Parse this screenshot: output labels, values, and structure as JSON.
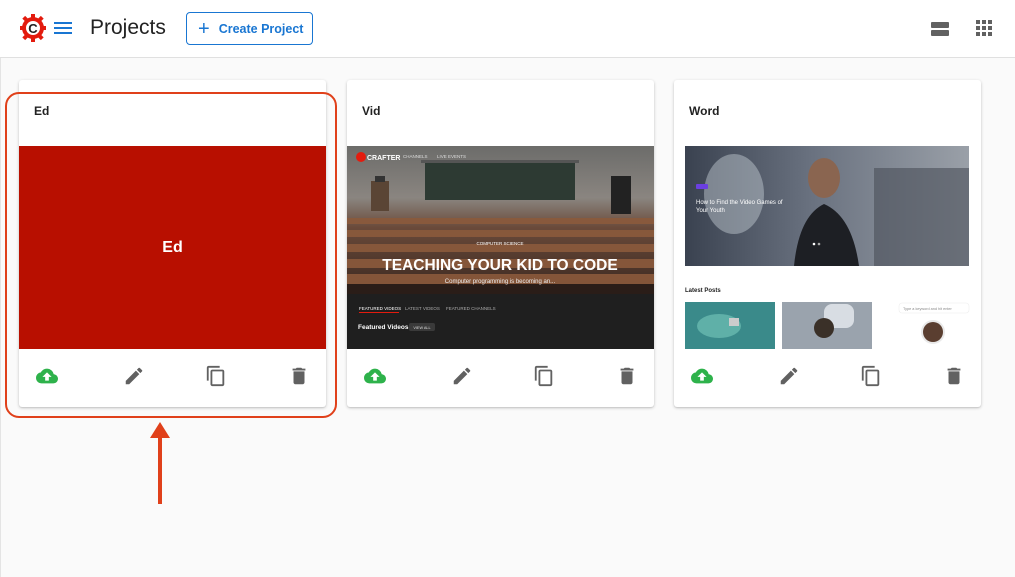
{
  "header": {
    "title": "Projects",
    "create_button_label": "Create Project"
  },
  "colors": {
    "accent": "#1976d2",
    "brand_red": "#e31b0e",
    "publish_green": "#2eb24b",
    "highlight": "#e0401a"
  },
  "projects": [
    {
      "title": "Ed",
      "thumbnail_text": "Ed",
      "thumbnail_bg": "#b80f00"
    },
    {
      "title": "Vid",
      "thumbnail": {
        "brand": "CRAFTER",
        "nav": [
          "CHANNELS",
          "LIVE EVENTS"
        ],
        "kicker": "COMPUTER SCIENCE",
        "headline": "TEACHING YOUR KID TO CODE",
        "sub": "Computer programming is becoming an...",
        "tabs": [
          "FEATURED VIDEOS",
          "LATEST VIDEOS",
          "FEATURED CHANNELS"
        ],
        "section": "Featured Videos",
        "view_all": "VIEW ALL"
      }
    },
    {
      "title": "Word",
      "thumbnail": {
        "hero_title": "How to Find the Video Games of Your Youth",
        "latest_posts": "Latest Posts",
        "search_placeholder": "Type a keyword and hit enter"
      }
    }
  ],
  "actions": {
    "publish": "cloud-upload-icon",
    "edit": "pencil-icon",
    "duplicate": "copy-icon",
    "delete": "trash-icon"
  }
}
